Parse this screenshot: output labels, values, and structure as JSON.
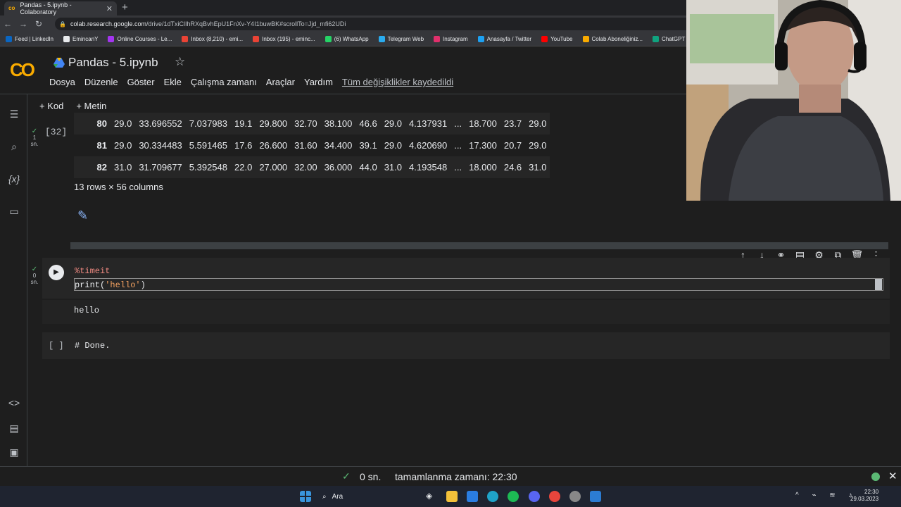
{
  "browser": {
    "tab_title": "Pandas - 5.ipynb - Colaboratory",
    "url_host": "colab.research.google.com",
    "url_path": "/drive/1dTxiClIhRXqBvhEpU1FnXv-Y4I1buwBK#scrollTo=Jjd_mfi62UDi",
    "bookmarks": [
      "Feed | LinkedIn",
      "EmincanY",
      "Online Courses - Le...",
      "Inbox (8,210) - emi...",
      "Inbox (195) - eminc...",
      "(6) WhatsApp",
      "Telegram Web",
      "Instagram",
      "Anasayfa / Twitter",
      "YouTube",
      "Colab Aboneliğiniz...",
      "ChatGPT"
    ]
  },
  "colab": {
    "logo": "CO",
    "notebook_title": "Pandas - 5.ipynb",
    "menu": [
      "Dosya",
      "Düzenle",
      "Göster",
      "Ekle",
      "Çalışma zamanı",
      "Araçlar",
      "Yardım"
    ],
    "saved_status": "Tüm değişiklikler kaydedildi",
    "toolbar": {
      "add_code": "+ Kod",
      "add_text": "+ Metin"
    }
  },
  "output_cell": {
    "exec_count": "[32]",
    "status_time": "1",
    "status_unit": "sn.",
    "rows": [
      [
        "80",
        "29.0",
        "33.696552",
        "7.037983",
        "19.1",
        "29.800",
        "32.70",
        "38.100",
        "46.6",
        "29.0",
        "4.137931",
        "...",
        "18.700",
        "23.7",
        "29.0"
      ],
      [
        "81",
        "29.0",
        "30.334483",
        "5.591465",
        "17.6",
        "26.600",
        "31.60",
        "34.400",
        "39.1",
        "29.0",
        "4.620690",
        "...",
        "17.300",
        "20.7",
        "29.0"
      ],
      [
        "82",
        "31.0",
        "31.709677",
        "5.392548",
        "22.0",
        "27.000",
        "32.00",
        "36.000",
        "44.0",
        "31.0",
        "4.193548",
        "...",
        "18.000",
        "24.6",
        "31.0"
      ]
    ],
    "shape_text": "13 rows × 56 columns"
  },
  "code_cell": {
    "status_time": "0",
    "status_unit": "sn.",
    "line1": "%timeit",
    "line2_prefix": "print(",
    "line2_string": "'hello'",
    "line2_suffix": ")",
    "output": "hello"
  },
  "empty_cell": {
    "brackets": "[ ]",
    "code": "# Done."
  },
  "statusbar": {
    "elapsed": "0 sn.",
    "completed": "tamamlanma zamanı: 22:30"
  },
  "taskbar": {
    "search_label": "Ara",
    "time": "22:30",
    "date": "29.03.2023"
  },
  "colors": {
    "accent": "#f9ab00",
    "success": "#5bb974",
    "link": "#8ab4f8"
  }
}
